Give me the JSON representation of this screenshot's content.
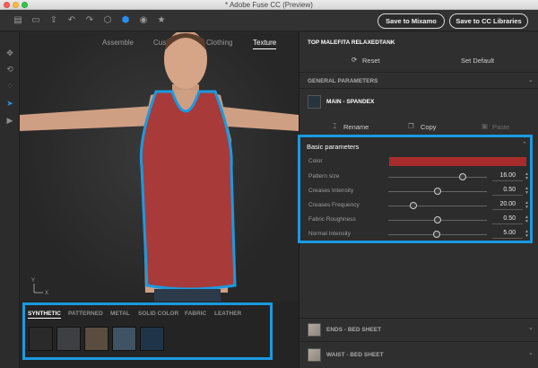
{
  "window": {
    "title": "* Adobe Fuse CC (Preview)"
  },
  "toolbar": {
    "icons": [
      "new-file-icon",
      "open-folder-icon",
      "export-icon",
      "undo-icon",
      "redo-icon",
      "cube-outline-icon",
      "cube-solid-icon",
      "camera-icon",
      "star-icon"
    ],
    "mixamo_label": "Save to Mixamo",
    "cc_label": "Save to CC Libraries"
  },
  "left_tools": [
    "move-icon",
    "orbit-icon",
    "rotate-icon",
    "select-cursor-icon",
    "camera-view-icon"
  ],
  "viewport": {
    "tabs": [
      {
        "label": "Assemble",
        "active": false
      },
      {
        "label": "Customize",
        "active": false
      },
      {
        "label": "Clothing",
        "active": false
      },
      {
        "label": "Texture",
        "active": true
      }
    ],
    "axis_y": "Y",
    "axis_x": "X"
  },
  "library": {
    "tabs": [
      {
        "label": "SYNTHETIC",
        "active": true
      },
      {
        "label": "PATTERNED",
        "active": false
      },
      {
        "label": "METAL",
        "active": false
      },
      {
        "label": "SOLID COLOR",
        "active": false
      },
      {
        "label": "FABRIC",
        "active": false
      },
      {
        "label": "LEATHER",
        "active": false
      }
    ],
    "swatches": [
      "#2a2a2a",
      "#3d3f42",
      "#5a4d40",
      "#3e5464",
      "#1f3448"
    ]
  },
  "panel": {
    "item_title": "TOP MALEFITA RELAXEDTANK",
    "reset_label": "Reset",
    "set_default_label": "Set Default",
    "general_label": "GENERAL PARAMETERS",
    "main_material": "MAIN - SPANDEX",
    "rename_label": "Rename",
    "copy_label": "Copy",
    "paste_label": "Paste",
    "basic_title": "Basic parameters",
    "color_label": "Color",
    "color_value": "#a82c2c",
    "params": [
      {
        "label": "Pattern size",
        "value": "16.00",
        "level": 0.75
      },
      {
        "label": "Creases Intensity",
        "value": "0.50",
        "level": 0.5
      },
      {
        "label": "Creases Frequency",
        "value": "20.00",
        "level": 0.25
      },
      {
        "label": "Fabric Roughness",
        "value": "0.50",
        "level": 0.5
      },
      {
        "label": "Normal Intensity",
        "value": "5.00",
        "level": 0.49
      }
    ],
    "ends_label": "ENDS - BED SHEET",
    "waist_label": "WAIST - BED SHEET"
  },
  "colors": {
    "accent": "#1b9ae0",
    "shirt": "#a83a3a",
    "skin": "#d9a88a"
  }
}
